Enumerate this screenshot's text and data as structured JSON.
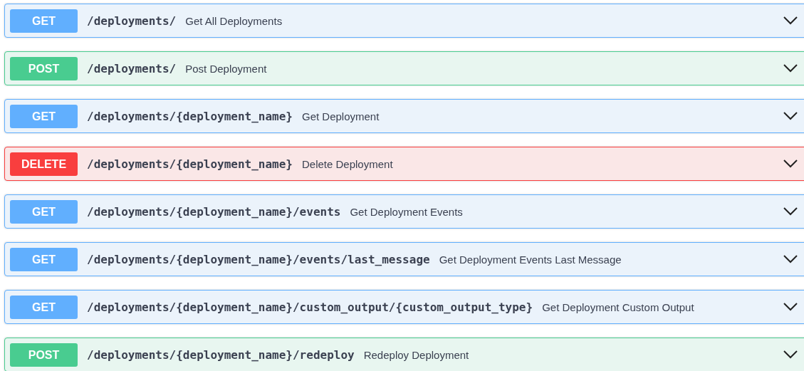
{
  "operations": [
    {
      "kind": "get",
      "method": "GET",
      "path": "/deployments/",
      "summary": "Get All Deployments",
      "expanded": false
    },
    {
      "kind": "post",
      "method": "POST",
      "path": "/deployments/",
      "summary": "Post Deployment",
      "expanded": false
    },
    {
      "kind": "get",
      "method": "GET",
      "path": "/deployments/{deployment_name}",
      "summary": "Get Deployment",
      "expanded": false
    },
    {
      "kind": "delete",
      "method": "DELETE",
      "path": "/deployments/{deployment_name}",
      "summary": "Delete Deployment",
      "expanded": false
    },
    {
      "kind": "get",
      "method": "GET",
      "path": "/deployments/{deployment_name}/events",
      "summary": "Get Deployment Events",
      "expanded": false
    },
    {
      "kind": "get",
      "method": "GET",
      "path": "/deployments/{deployment_name}/events/last_message",
      "summary": "Get Deployment Events Last Message",
      "expanded": false
    },
    {
      "kind": "get",
      "method": "GET",
      "path": "/deployments/{deployment_name}/custom_output/{custom_output_type}",
      "summary": "Get Deployment Custom Output",
      "expanded": false
    },
    {
      "kind": "post",
      "method": "POST",
      "path": "/deployments/{deployment_name}/redeploy",
      "summary": "Redeploy Deployment",
      "expanded": false
    }
  ]
}
